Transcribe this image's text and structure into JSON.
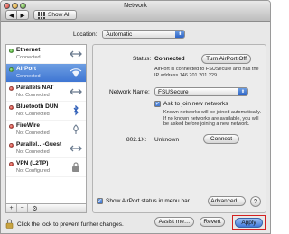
{
  "window": {
    "title": "Network"
  },
  "toolbar": {
    "back_label": "◀",
    "forward_label": "▶",
    "show_all_label": "Show All"
  },
  "location": {
    "label": "Location:",
    "value": "Automatic"
  },
  "services": [
    {
      "name": "Ethernet",
      "status": "Connected",
      "status_color": "green",
      "icon": "ethernet-icon"
    },
    {
      "name": "AirPort",
      "status": "Connected",
      "status_color": "green",
      "icon": "wifi-icon",
      "selected": true
    },
    {
      "name": "Parallels NAT",
      "status": "Not Connected",
      "status_color": "red",
      "icon": "ethernet-icon"
    },
    {
      "name": "Bluetooth DUN",
      "status": "Not Connected",
      "status_color": "red",
      "icon": "bluetooth-icon"
    },
    {
      "name": "FireWire",
      "status": "Not Connected",
      "status_color": "red",
      "icon": "firewire-icon"
    },
    {
      "name": "Parallel…-Guest",
      "status": "Not Connected",
      "status_color": "red",
      "icon": "ethernet-icon"
    },
    {
      "name": "VPN (L2TP)",
      "status": "Not Configured",
      "status_color": "red",
      "icon": "vpn-icon"
    }
  ],
  "sidebar_buttons": {
    "add": "+",
    "remove": "−",
    "action": "⚙"
  },
  "detail": {
    "status_label": "Status:",
    "status_value": "Connected",
    "turn_off_label": "Turn AirPort Off",
    "status_desc": "AirPort is connected to FSUSecure and has the IP address 146.201.201.229.",
    "network_name_label": "Network Name:",
    "network_name_value": "FSUSecure",
    "ask_join_label": "Ask to join new networks",
    "ask_join_desc": "Known networks will be joined automatically. If no known networks are available, you will be asked before joining a new network.",
    "x8021_label": "802.1X:",
    "x8021_value": "Unknown",
    "connect_label": "Connect",
    "show_status_label": "Show AirPort status in menu bar",
    "advanced_label": "Advanced…",
    "help_label": "?"
  },
  "footer": {
    "lock_text": "Click the lock to prevent further changes.",
    "assist_label": "Assist me…",
    "revert_label": "Revert",
    "apply_label": "Apply"
  },
  "colors": {
    "accent": "#3f76d3",
    "highlight": "#d32020",
    "connected": "#2fa21a",
    "disconnected": "#d0251b"
  }
}
